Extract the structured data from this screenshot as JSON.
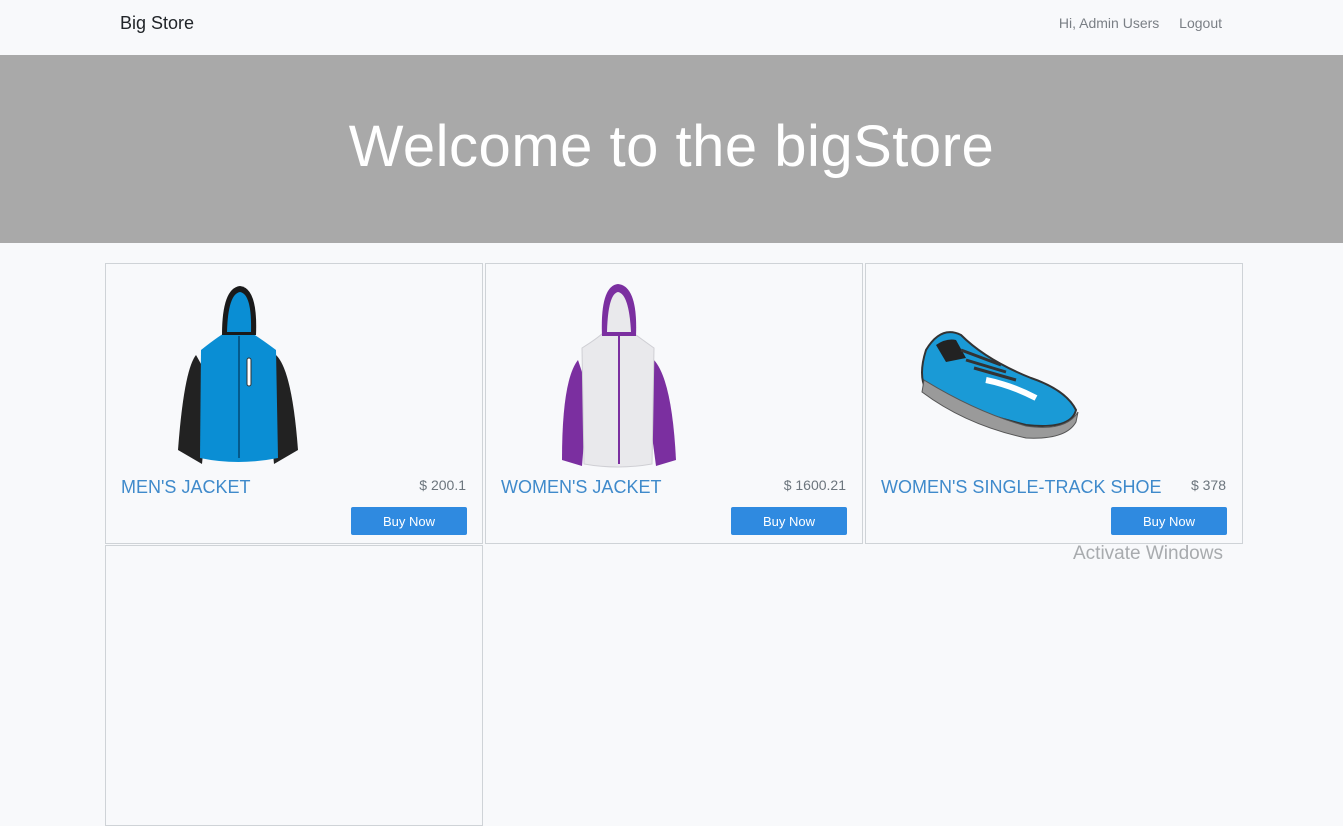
{
  "navbar": {
    "brand": "Big Store",
    "greeting": "Hi, Admin Users",
    "logout": "Logout"
  },
  "hero": {
    "title": "Welcome to the bigStore"
  },
  "products": [
    {
      "name": "MEN'S JACKET",
      "price": "$ 200.1",
      "button": "Buy Now",
      "image": "mens-jacket-image"
    },
    {
      "name": "WOMEN'S JACKET",
      "price": "$ 1600.21",
      "button": "Buy Now",
      "image": "womens-jacket-image"
    },
    {
      "name": "WOMEN'S SINGLE-TRACK SHOE",
      "price": "$ 378",
      "button": "Buy Now",
      "image": "shoe-image"
    }
  ],
  "watermark": "Activate Windows",
  "colors": {
    "hero_bg": "#a9a9a9",
    "link": "#3f8acb",
    "button": "#2f8ae0"
  }
}
